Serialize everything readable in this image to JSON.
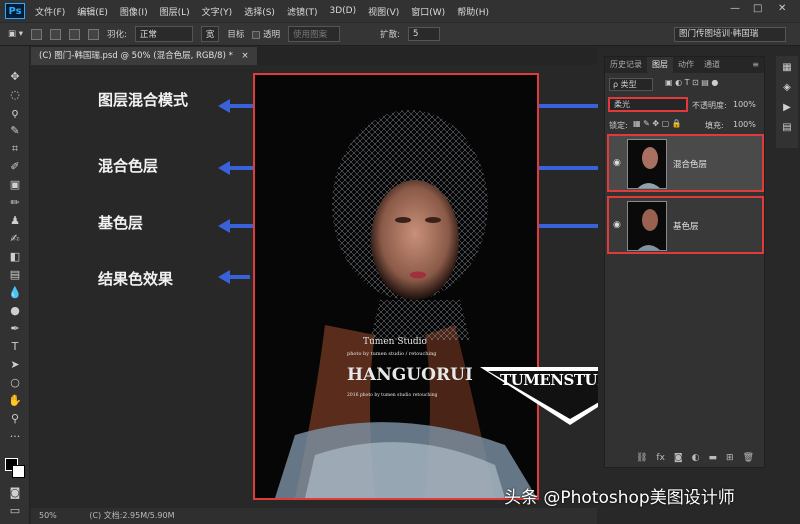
{
  "app": {
    "logo": "Ps"
  },
  "menu": [
    "文件(F)",
    "编辑(E)",
    "图像(I)",
    "图层(L)",
    "文字(Y)",
    "选择(S)",
    "滤镜(T)",
    "3D(D)",
    "视图(V)",
    "窗口(W)",
    "帮助(H)"
  ],
  "window_controls": [
    "—",
    "□",
    "✕"
  ],
  "options": {
    "feather_label": "羽化:",
    "mode_label": "正常",
    "width_label": "宽",
    "target_label": "目标",
    "transparent_label": "透明",
    "use_pattern_label": "使用图案",
    "diffusion_label": "扩散:",
    "diffusion_value": "5",
    "workspace": "图门传图培训·韩国瑞"
  },
  "document_tab": {
    "title": "(C) 图门-韩国瑞.psd @ 50% (混合色层, RGB/8) *",
    "close": "×"
  },
  "status": {
    "zoom": "50%",
    "doc_info": "(C) 文档:2.95M/5.90M"
  },
  "annotations": [
    {
      "label": "图层混合模式"
    },
    {
      "label": "混合色层"
    },
    {
      "label": "基色层"
    },
    {
      "label": "结果色效果"
    }
  ],
  "photo_watermark": {
    "studio": "Tumen Studio",
    "line1": "photo by tumen studio / retouching",
    "name": "HANGUORUI",
    "line2": "2016 photo by tumen studio retouching",
    "logo": "TUMENSTUDIO"
  },
  "panel": {
    "tabs": [
      "历史记录",
      "图层",
      "动作",
      "通道"
    ],
    "filter_label": "ρ 类型",
    "blend_mode": "柔光",
    "opacity_label": "不透明度:",
    "opacity_value": "100%",
    "lock_label": "锁定:",
    "fill_label": "填充:",
    "fill_value": "100%",
    "layers": [
      {
        "name": "混合色层"
      },
      {
        "name": "基色层"
      }
    ],
    "bottom_icons": [
      "link-icon",
      "fx-icon",
      "mask-icon",
      "adjustment-icon",
      "group-icon",
      "new-layer-icon",
      "trash-icon"
    ]
  },
  "footer_watermark": "头条 @Photoshop美图设计师"
}
